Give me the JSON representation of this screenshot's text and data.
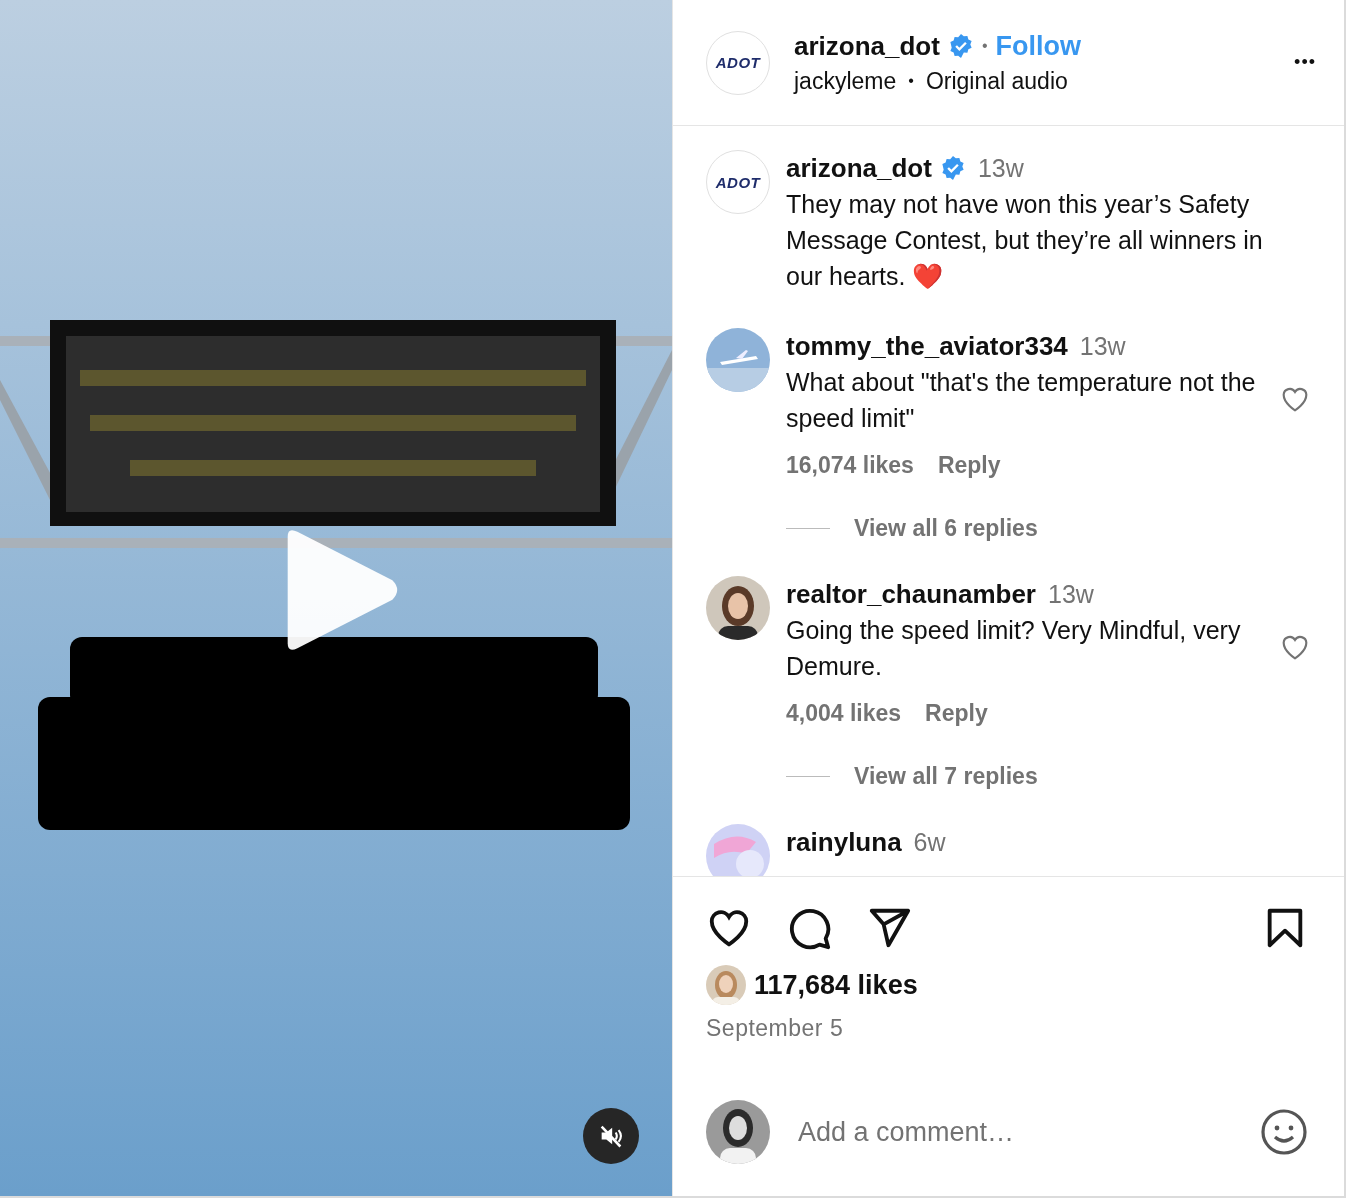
{
  "video": {
    "kind": "picture",
    "muted": true,
    "playing": false
  },
  "header": {
    "avatar_logo": "ADOT",
    "username": "arizona_dot",
    "verified": true,
    "separator": "•",
    "follow": "Follow",
    "audio_user": "jackyleme",
    "audio_separator": "•",
    "audio": "Original audio",
    "more": "•••"
  },
  "caption": {
    "avatar_logo": "ADOT",
    "username": "arizona_dot",
    "verified": true,
    "time": "13w",
    "text": "They may not have won this year’s Safety Message Contest, but they’re all winners in our hearts. ❤️"
  },
  "comments": [
    {
      "username": "tommy_the_aviator334",
      "time": "13w",
      "text": "What about \"that's the temperature not the speed limit\"",
      "likes": "16,074 likes",
      "reply": "Reply",
      "view_replies": "View all 6 replies",
      "liked": false
    },
    {
      "username": "realtor_chaunamber",
      "time": "13w",
      "text": "Going the speed limit? Very Mindful, very Demure.",
      "likes": "4,004 likes",
      "reply": "Reply",
      "view_replies": "View all 7 replies",
      "liked": false
    },
    {
      "username": "rainyluna",
      "time": "6w"
    }
  ],
  "actions": {
    "liked": false,
    "saved": false
  },
  "likes": "117,684 likes",
  "date": "September 5",
  "comment_box": {
    "placeholder": "Add a comment…"
  }
}
